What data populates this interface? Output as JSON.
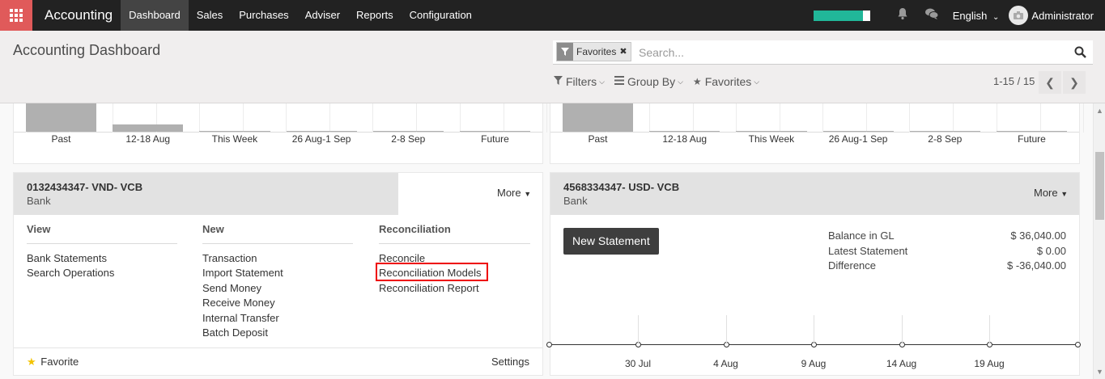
{
  "navbar": {
    "brand": "Accounting",
    "menu": [
      "Dashboard",
      "Sales",
      "Purchases",
      "Adviser",
      "Reports",
      "Configuration"
    ],
    "active_index": 0,
    "progress_fraction": 0.88,
    "language": "English",
    "user": "Administrator"
  },
  "control_panel": {
    "title": "Accounting Dashboard",
    "facet_label": "Favorites",
    "facet_remove": "✖",
    "search_placeholder": "Search...",
    "filters": "Filters",
    "group_by": "Group By",
    "favorites": "Favorites",
    "pager": "1-15 / 15"
  },
  "top_charts": {
    "labels": [
      "Past",
      "12-18 Aug",
      "This Week",
      "26 Aug-1 Sep",
      "2-8 Sep",
      "Future"
    ],
    "left_values": [
      1.0,
      0.26,
      0.02,
      0.02,
      0.02,
      0.02
    ],
    "right_values": [
      1.0,
      0.02,
      0.02,
      0.02,
      0.02,
      0.02
    ]
  },
  "journal_left": {
    "name": "0132434347- VND- VCB",
    "type": "Bank",
    "more": "More",
    "view_title": "View",
    "view_links": [
      "Bank Statements",
      "Search Operations"
    ],
    "new_title": "New",
    "new_links": [
      "Transaction",
      "Import Statement",
      "Send Money",
      "Receive Money",
      "Internal Transfer",
      "Batch Deposit"
    ],
    "rec_title": "Reconciliation",
    "rec_links": [
      "Reconcile",
      "Reconciliation Models",
      "Reconciliation Report"
    ],
    "favorite": "Favorite",
    "settings": "Settings"
  },
  "journal_right": {
    "name": "4568334347- USD- VCB",
    "type": "Bank",
    "more": "More",
    "new_statement": "New Statement",
    "balances": [
      {
        "label": "Balance in GL",
        "value": "$ 36,040.00"
      },
      {
        "label": "Latest Statement",
        "value": "$ 0.00"
      },
      {
        "label": "Difference",
        "value": "$ -36,040.00"
      }
    ],
    "timeline_labels": [
      "30 Jul",
      "4 Aug",
      "9 Aug",
      "14 Aug",
      "19 Aug"
    ]
  },
  "icons": {
    "apps": "apps-grid-icon",
    "bell": "bell-icon",
    "chat": "chat-icon",
    "filter": "filter-icon",
    "search": "search-icon",
    "star": "star-icon"
  },
  "colors": {
    "apps_button": "#e05a5a",
    "navbar": "#222222",
    "progress": "#21b799",
    "highlight": "#ee0000",
    "favorite_star": "#f3c300"
  }
}
